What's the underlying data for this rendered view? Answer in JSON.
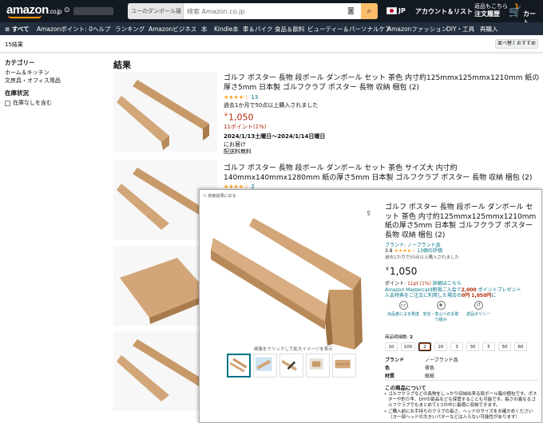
{
  "header": {
    "logo": "amazon",
    "logo_suffix": ".co.jp",
    "search_category": "ユーのダンボール撮影",
    "search_placeholder": "検索 Amazon.co.jp",
    "lang": "JP",
    "account": "アカウント＆リスト",
    "orders_line1": "返品もこちら",
    "orders_line2": "注文履歴",
    "cart_count": "1",
    "cart_label": "カート"
  },
  "nav": [
    "≡ すべて",
    "Amazonポイント: 0",
    "ヘルプ",
    "ランキング",
    "Amazonビジネス",
    "本",
    "Kindle本",
    "車＆バイク",
    "食品＆飲料",
    "ビューティー＆パーソナルケア",
    "Amazonファッション",
    "DIY・工具",
    "再購入"
  ],
  "subbar": {
    "results": "15結果",
    "sort1": "並べ替え",
    "sort2": "おすすめ"
  },
  "sidebar": {
    "category_heading": "カテゴリー",
    "categories": [
      "ホーム＆キッチン",
      "文房具・オフィス用品"
    ],
    "stock_heading": "在庫状況",
    "stock_option": "在庫なしを含む"
  },
  "results_heading": "結果",
  "items": [
    {
      "title": "ゴルフ ポスター 長物 段ボール ダンボール セット 茶色 内寸約125mmx125mmx1210mm 紙の厚さ5mm 日本製 ゴルフクラブ ポスター 長物 収納 梱包 (2)",
      "stars": "★★★★☆",
      "rating_count": "13",
      "bought": "過去1か月で50点以上購入されました",
      "price_symbol": "￥",
      "price": "1,050",
      "points": "11ポイント(1%)",
      "delivery_date": "2024/1/13土曜日～2024/1/14日曜日",
      "delivery_note": "にお届け",
      "shipping": "配送料無料"
    },
    {
      "title": "ゴルフ ポスター 長物 段ボール ダンボール セット 茶色 サイズ大 内寸約140mmx140mmx1280mm 紙の厚さ5mm 日本製 ゴルフクラブ ポスター 長物 収納 梱包 (2)",
      "stars": "★★★★☆",
      "rating_count": "2"
    }
  ],
  "popup": {
    "back": "＜ 検索結果に戻る",
    "zoom_hint": "画像をクリックして拡大イメージを表示",
    "title": "ゴルフ ポスター 長物 段ボール ダンボール セット 茶色 内寸約125mmx125mmx1210mm 紙の厚さ5mm 日本製 ゴルフクラブ ポスター 長物 収納 梱包 (2)",
    "brand": "ブランド: ノーブランド品",
    "rating_value": "3.8",
    "stars": "★★★★☆",
    "rating_count": "13個の評価",
    "bought": "過去1か月で50点以上購入されました",
    "price_symbol": "￥",
    "price": "1,050",
    "points_label": "ポイント:",
    "points": "11pt (1%)",
    "points_link": "詳細はこちら",
    "mc_line": "Amazon Mastercard新規ご入会で",
    "mc_bonus": "2,000",
    "mc_line_end": "ポイントプレゼント",
    "mc_line2": "入会特典をご注文に利用した場合の",
    "mc_line2_bold": "0円 1,050円",
    "mc_line2_end": "に",
    "features": [
      "出品者による発送",
      "安全・安心へのお取り組み",
      "返品ポリシー"
    ],
    "qty_label": "商品明細数:",
    "qty_selected": "2",
    "options": [
      "10",
      "100",
      "2",
      "20",
      "3",
      "30",
      "5",
      "50",
      "60"
    ],
    "specs": [
      {
        "k": "ブランド",
        "v": "ノーブランド品"
      },
      {
        "k": "色",
        "v": "茶色"
      },
      {
        "k": "材質",
        "v": "紙紙"
      }
    ],
    "about_heading": "この商品について",
    "bullets": [
      "ゴルフクラブなどの長物をしっかり収納出来る段ボール箱の梱包です。ポスターや釣り竿、DIYの部品なども保管することも可能です。長さの異なるゴルフクラブでもまとめて1つの中に最適に収納できます。",
      "ご購入前にお手持ちのクラブの長さ、ヘッドのサイズをお確かめください（ヨー部ヘッドの大きいパターなどは入らない可能性があります）"
    ]
  }
}
